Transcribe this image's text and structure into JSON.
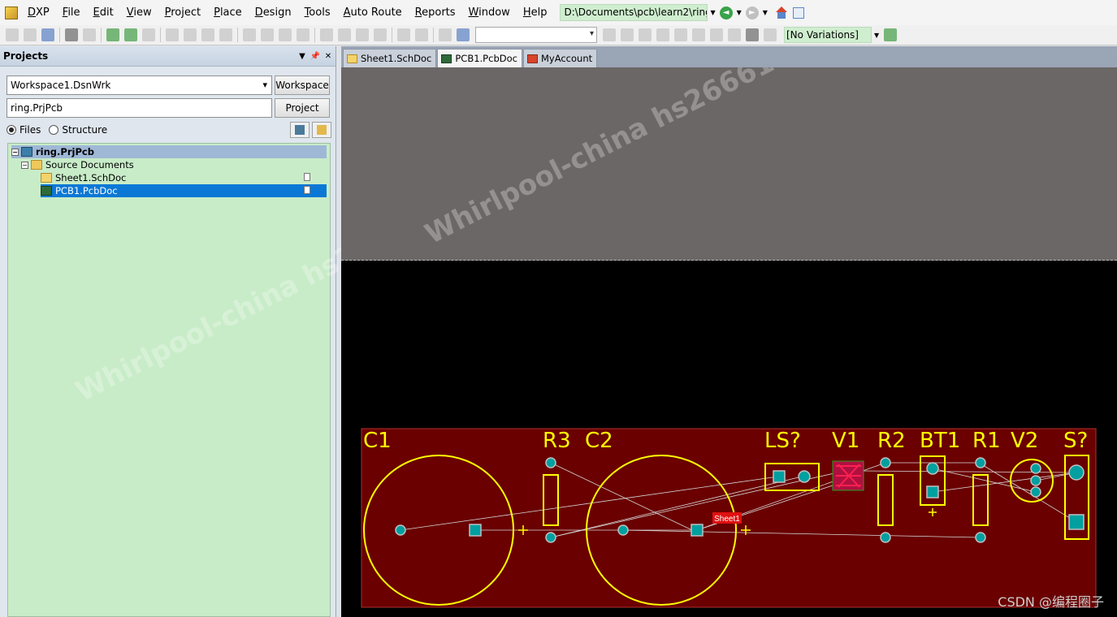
{
  "app": {
    "logo_label": "DXP",
    "menu": [
      "File",
      "Edit",
      "View",
      "Project",
      "Place",
      "Design",
      "Tools",
      "Auto Route",
      "Reports",
      "Window",
      "Help"
    ],
    "path": "D:\\Documents\\pcb\\learn2\\ring\\",
    "variations": "[No Variations]"
  },
  "panel": {
    "title": "Projects",
    "workspace": "Workspace1.DsnWrk",
    "workspace_button": "Workspace",
    "project": "ring.PrjPcb",
    "project_button": "Project",
    "view_files": "Files",
    "view_structure": "Structure",
    "tree": {
      "project": "ring.PrjPcb",
      "folder": "Source Documents",
      "docs": [
        "Sheet1.SchDoc",
        "PCB1.PcbDoc"
      ]
    }
  },
  "tabs": [
    "Sheet1.SchDoc",
    "PCB1.PcbDoc",
    "MyAccount"
  ],
  "pcb": {
    "designators": [
      "C1",
      "R3",
      "C2",
      "LS?",
      "V1",
      "R2",
      "BT1",
      "R1",
      "V2",
      "S?"
    ],
    "room_label": "Sheet1"
  },
  "watermark": "Whirlpool-china  hs26661",
  "footer_mark": "CSDN @编程圈子",
  "colors": {
    "board": "#6a0000",
    "silk": "#ffff00",
    "pad": "#00a0a0",
    "tree_bg": "#c8ecc8",
    "selection": "#0b78d6"
  }
}
